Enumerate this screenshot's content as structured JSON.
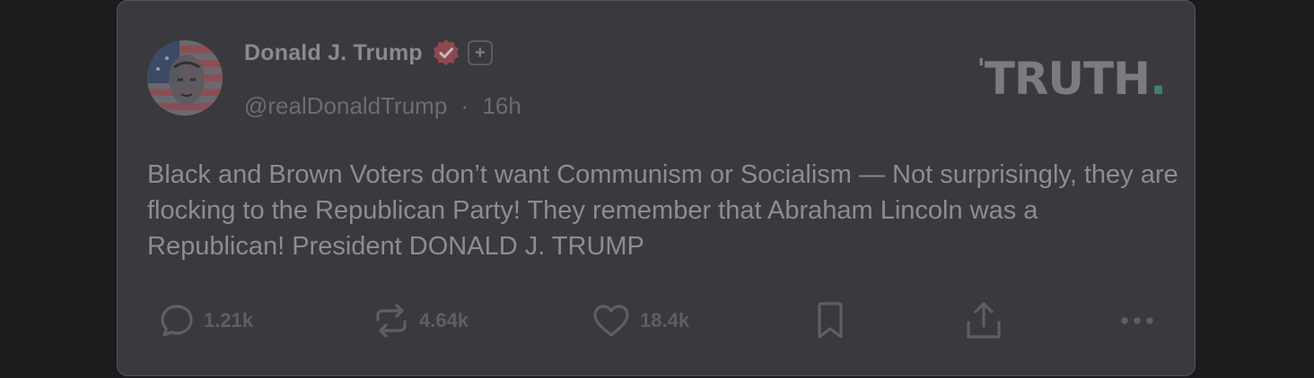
{
  "post": {
    "author_name": "Donald J. Trump",
    "handle": "@realDonaldTrump",
    "separator": "·",
    "time": "16h",
    "plus_badge": "+",
    "text": "Black and Brown Voters don’t want Communism or Socialism — Not surprisingly, they are flocking to the Republican Party! They remember that Abraham Lincoln was a Republican! President DONALD J. TRUMP"
  },
  "brand": {
    "logo_text": "TRUTH",
    "logo_dot": "."
  },
  "actions": {
    "replies": "1.21k",
    "retruths": "4.64k",
    "likes": "18.4k"
  },
  "icons": {
    "reply": "reply-bubble-icon",
    "retruth": "retruth-arrows-icon",
    "like": "heart-icon",
    "bookmark": "bookmark-icon",
    "share": "share-upload-icon",
    "more": "more-dots-icon",
    "verified": "verified-badge-icon"
  },
  "colors": {
    "background": "#1c1c1e",
    "card": "#3a393e",
    "verified_badge": "#8e4850",
    "logo_dot": "#3f7f74"
  }
}
